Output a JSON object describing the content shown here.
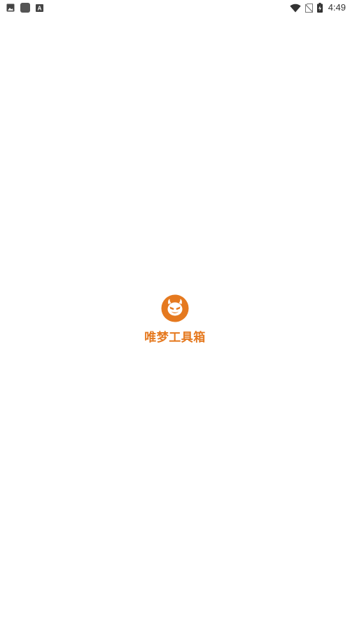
{
  "status_bar": {
    "left_icons": [
      "image-icon",
      "app-square-icon",
      "a-letter-icon"
    ],
    "right_icons": [
      "wifi-icon",
      "no-sim-icon",
      "battery-charging-icon"
    ],
    "a_glyph": "A",
    "time": "4:49"
  },
  "splash": {
    "logo_icon": "devil-face-logo-icon",
    "app_name": "唯梦工具箱",
    "accent_color": "#e5791f"
  }
}
